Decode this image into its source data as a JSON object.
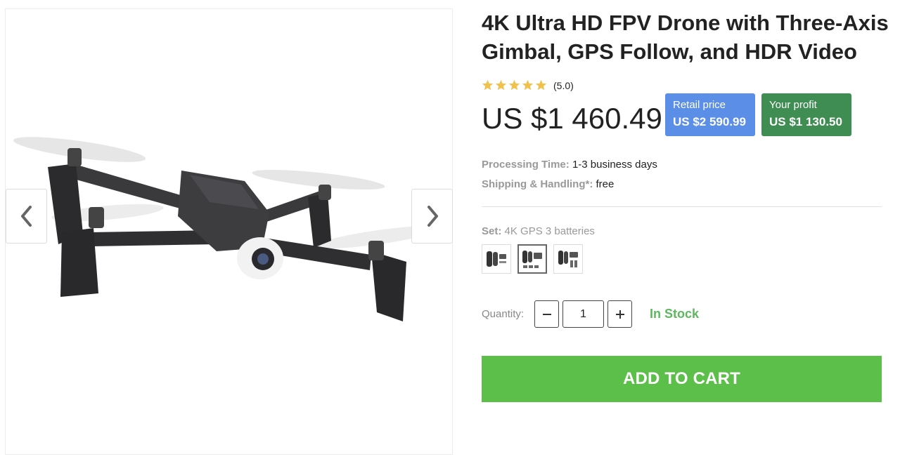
{
  "product": {
    "title": "4K Ultra HD FPV Drone with Three-Axis Gimbal, GPS Follow, and HDR Video",
    "rating": {
      "stars": 5,
      "text": "(5.0)"
    },
    "price": "US $1 460.49",
    "retail": {
      "label": "Retail price",
      "value": "US $2 590.99"
    },
    "profit": {
      "label": "Your profit",
      "value": "US $1 130.50"
    }
  },
  "details": {
    "processing": {
      "label": "Processing Time:",
      "value": "1-3 business days"
    },
    "shipping": {
      "label": "Shipping & Handling*:",
      "value": "free"
    }
  },
  "set": {
    "label": "Set:",
    "value": "4K GPS 3 batteries",
    "options": [
      "option-1",
      "option-2",
      "option-3"
    ],
    "selected_index": 1
  },
  "quantity": {
    "label": "Quantity:",
    "value": "1",
    "stock": "In Stock"
  },
  "cart": {
    "label": "ADD TO CART"
  },
  "colors": {
    "star": "#f0c14b",
    "retail": "#5b8ee6",
    "profit": "#3f8d52",
    "cart": "#5cbf4a",
    "stock": "#5cb85c"
  },
  "icons": {
    "prev": "chevron-left-icon",
    "next": "chevron-right-icon",
    "minus": "minus-icon",
    "plus": "plus-icon",
    "star": "star-icon"
  }
}
